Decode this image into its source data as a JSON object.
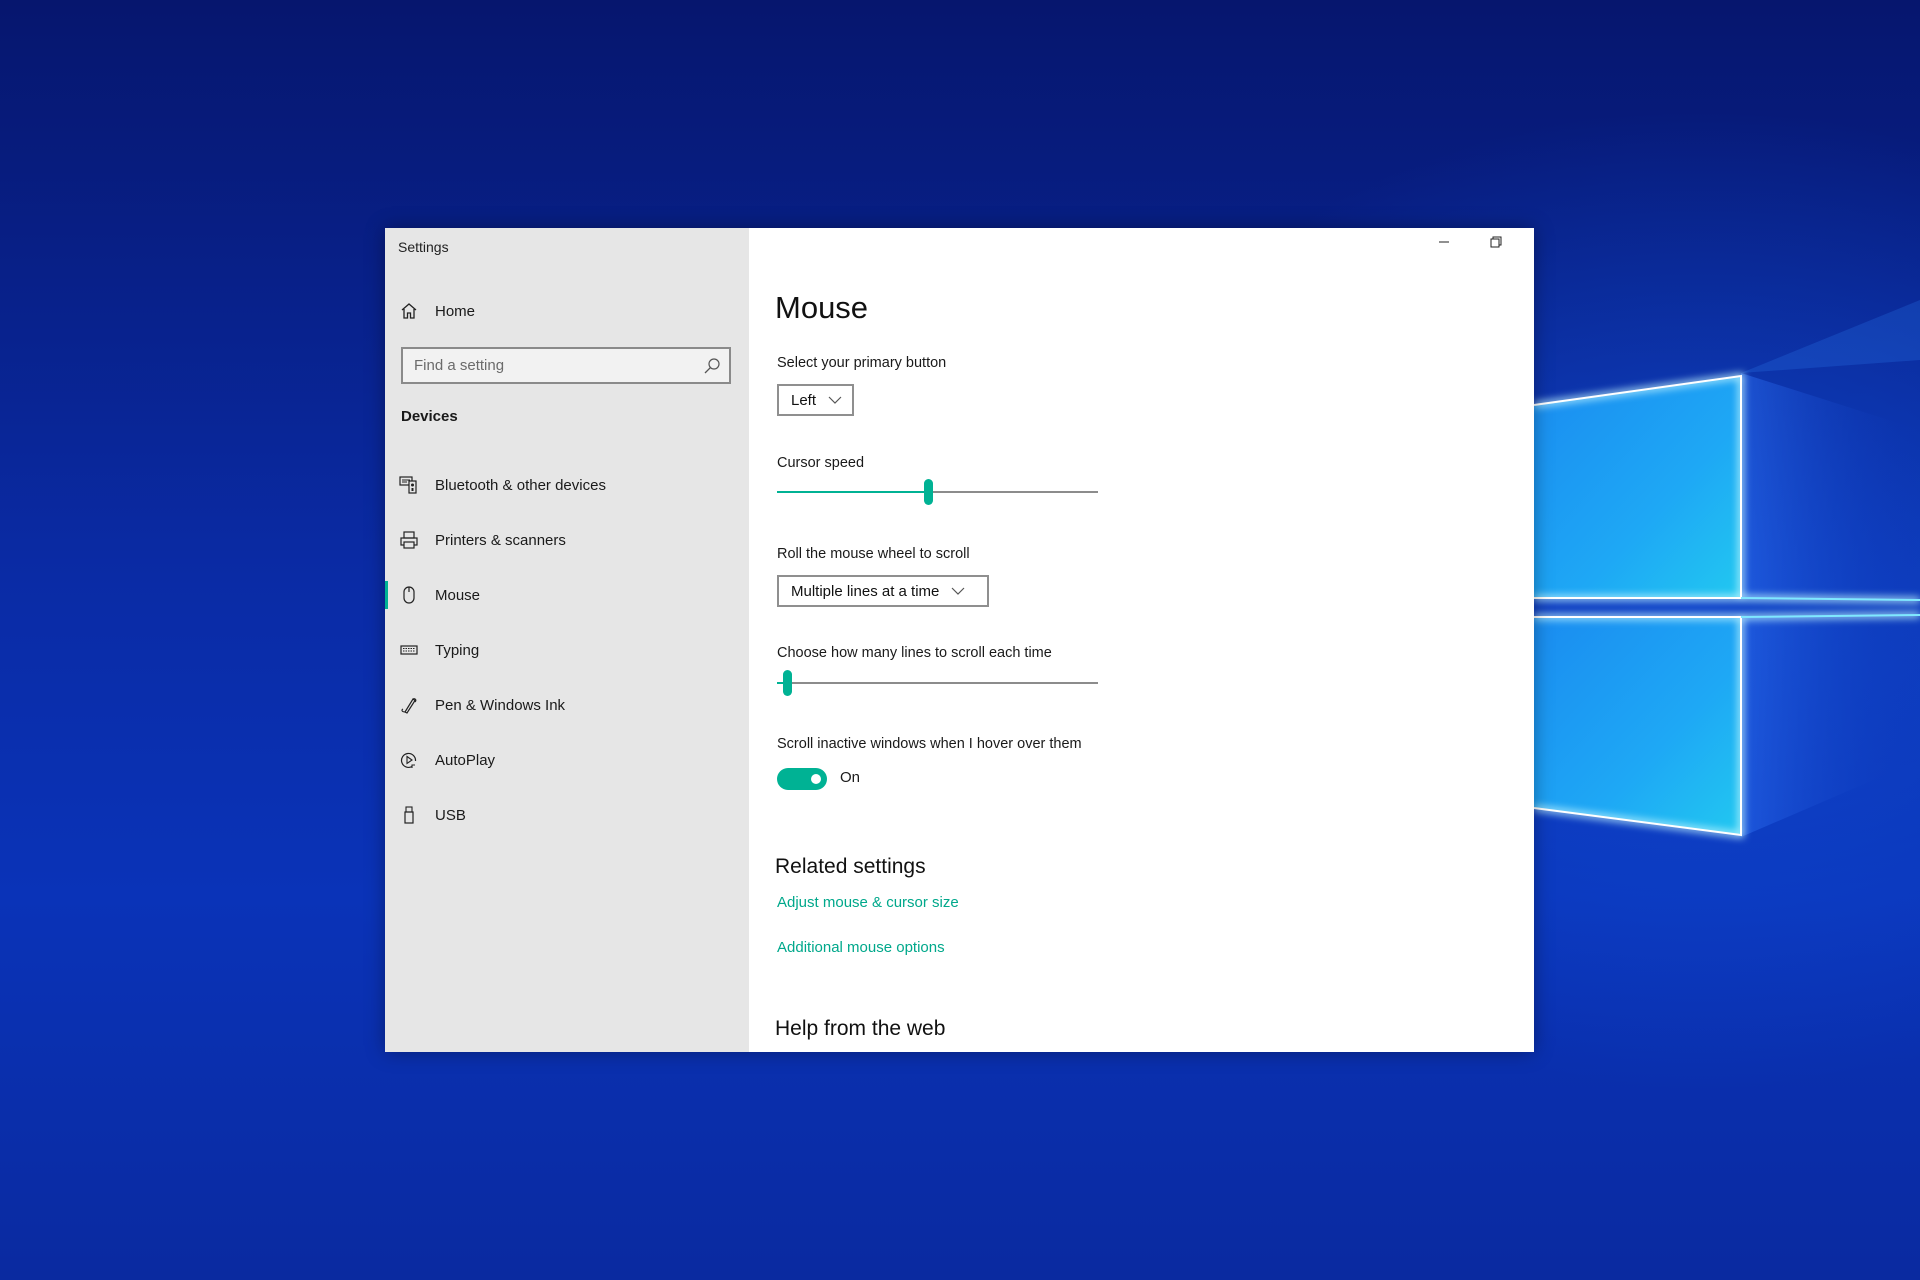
{
  "window": {
    "title": "Settings",
    "controls": {
      "minimize": "minimize-icon",
      "restore": "restore-icon"
    }
  },
  "sidebar": {
    "home": {
      "label": "Home",
      "icon": "home-icon"
    },
    "search": {
      "placeholder": "Find a setting",
      "value": "",
      "icon": "search-icon"
    },
    "section": "Devices",
    "items": [
      {
        "label": "Bluetooth & other devices",
        "icon": "bluetooth-devices-icon",
        "active": false
      },
      {
        "label": "Printers & scanners",
        "icon": "printer-icon",
        "active": false
      },
      {
        "label": "Mouse",
        "icon": "mouse-icon",
        "active": true
      },
      {
        "label": "Typing",
        "icon": "keyboard-icon",
        "active": false
      },
      {
        "label": "Pen & Windows Ink",
        "icon": "pen-icon",
        "active": false
      },
      {
        "label": "AutoPlay",
        "icon": "autoplay-icon",
        "active": false
      },
      {
        "label": "USB",
        "icon": "usb-icon",
        "active": false
      }
    ]
  },
  "main": {
    "title": "Mouse",
    "primary_button": {
      "label": "Select your primary button",
      "value": "Left"
    },
    "cursor_speed": {
      "label": "Cursor speed",
      "value_fraction": 0.47
    },
    "wheel_scroll": {
      "label": "Roll the mouse wheel to scroll",
      "value": "Multiple lines at a time"
    },
    "lines_to_scroll": {
      "label": "Choose how many lines to scroll each time",
      "value_fraction": 0.03
    },
    "scroll_inactive": {
      "label": "Scroll inactive windows when I hover over them",
      "state": "On",
      "on": true
    },
    "related": {
      "heading": "Related settings",
      "links": [
        "Adjust mouse & cursor size",
        "Additional mouse options"
      ]
    },
    "help": {
      "heading": "Help from the web"
    }
  },
  "colors": {
    "accent": "#00b294",
    "link": "#00a88b",
    "sidebar_bg": "#e6e6e6"
  }
}
